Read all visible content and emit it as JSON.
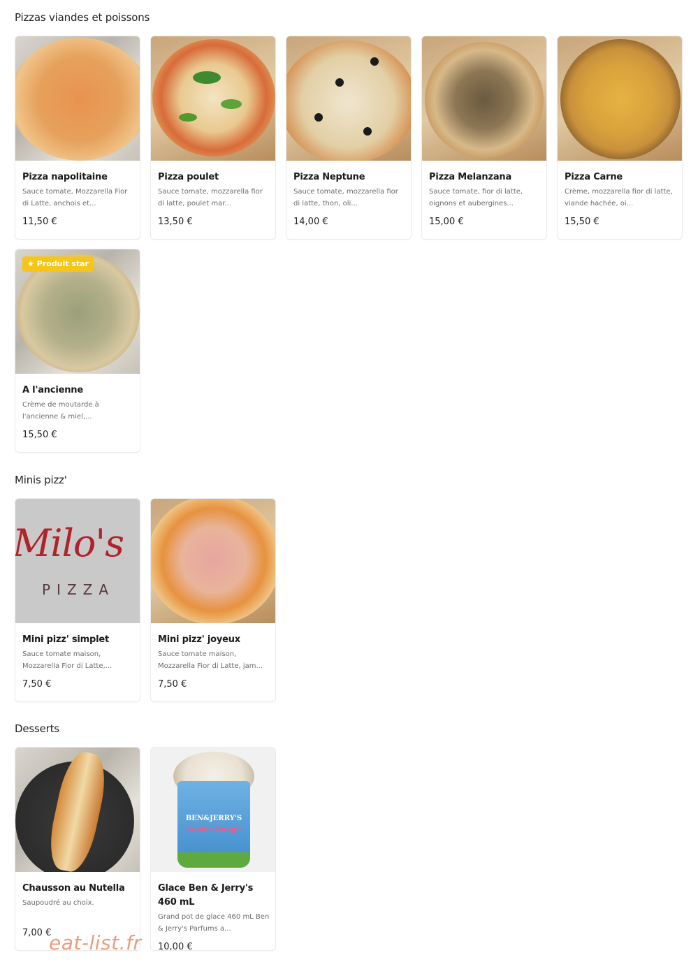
{
  "sections": [
    {
      "title": "Pizzas viandes et poissons",
      "items": [
        {
          "name": "Pizza napolitaine",
          "desc": "Sauce tomate, Mozzarella Fior di Latte, anchois et...",
          "price": "11,50 €"
        },
        {
          "name": "Pizza poulet",
          "desc": "Sauce tomate, mozzarella fior di latte, poulet mar...",
          "price": "13,50 €"
        },
        {
          "name": "Pizza Neptune",
          "desc": "Sauce tomate, mozzarella fior di latte, thon, oli...",
          "price": "14,00 €"
        },
        {
          "name": "Pizza Melanzana",
          "desc": "Sauce tomate, fior di latte, oignons et aubergines...",
          "price": "15,00 €"
        },
        {
          "name": "Pizza Carne",
          "desc": "Crème, mozzarella fior di latte, viande hachée, oi...",
          "price": "15,50 €"
        },
        {
          "name": "A l'ancienne",
          "desc": "Crème de moutarde à l'ancienne & miel,...",
          "price": "15,50 €",
          "badge": "★ Produit star"
        }
      ]
    },
    {
      "title": "Minis pizz'",
      "items": [
        {
          "name": "Mini pizz' simplet",
          "desc": "Sauce tomate maison, Mozzarella Fior di Latte,...",
          "price": "7,50 €",
          "logo_script": "Milo's",
          "logo_word": "PIZZA"
        },
        {
          "name": "Mini pizz' joyeux",
          "desc": "Sauce tomate maison, Mozzarella Fior di Latte, jam...",
          "price": "7,50 €"
        }
      ]
    },
    {
      "title": "Desserts",
      "items": [
        {
          "name": "Chausson au Nutella",
          "desc": "Saupoudré au choix.",
          "price": "7,00 €"
        },
        {
          "name": "Glace Ben & Jerry's 460 mL",
          "desc": "Grand pot de glace 460 mL Ben & Jerry's Parfums a...",
          "price": "10,00 €",
          "pot_brand": "BEN&JERRY'S",
          "pot_flavor": "Cookie Dough"
        }
      ]
    }
  ],
  "watermark": "eat-list.fr",
  "colors": {
    "badge": "#f5c518",
    "watermark": "#e8936a",
    "logo_red": "#b0232a"
  }
}
